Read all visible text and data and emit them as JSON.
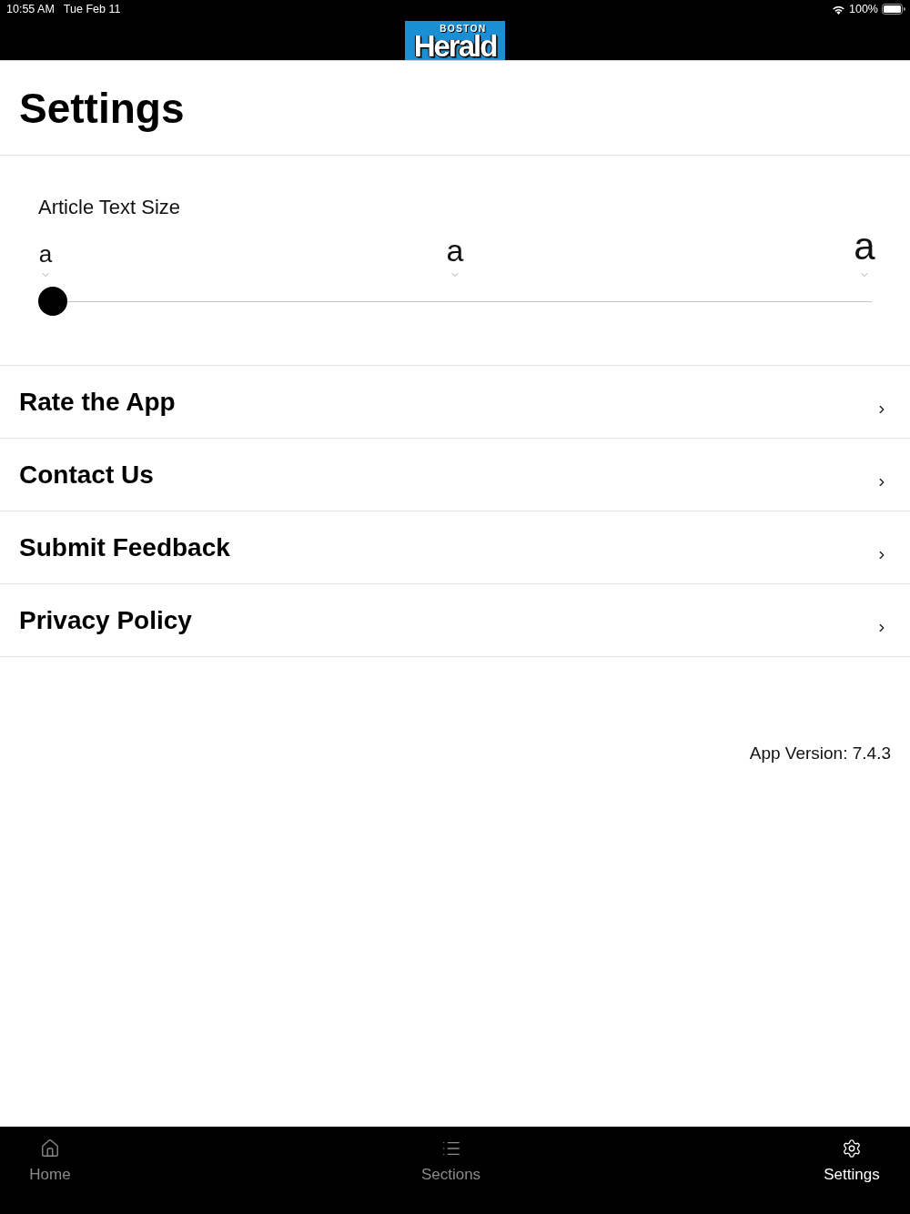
{
  "status_bar": {
    "time": "10:55 AM",
    "date": "Tue Feb 11",
    "battery": "100%"
  },
  "header": {
    "logo": {
      "top": "BOSTON",
      "main": "Herald"
    }
  },
  "title": "Settings",
  "text_size": {
    "label": "Article Text Size",
    "options": [
      "a",
      "a",
      "a"
    ],
    "level": 0
  },
  "menu_items": [
    {
      "label": "Rate the App"
    },
    {
      "label": "Contact Us"
    },
    {
      "label": "Submit Feedback"
    },
    {
      "label": "Privacy Policy"
    }
  ],
  "app_version": "App Version: 7.4.3",
  "tab_bar": [
    {
      "kind": "home",
      "label": "Home",
      "selected": false
    },
    {
      "kind": "sections",
      "label": "Sections",
      "selected": false
    },
    {
      "kind": "settings",
      "label": "Settings",
      "selected": true
    }
  ]
}
